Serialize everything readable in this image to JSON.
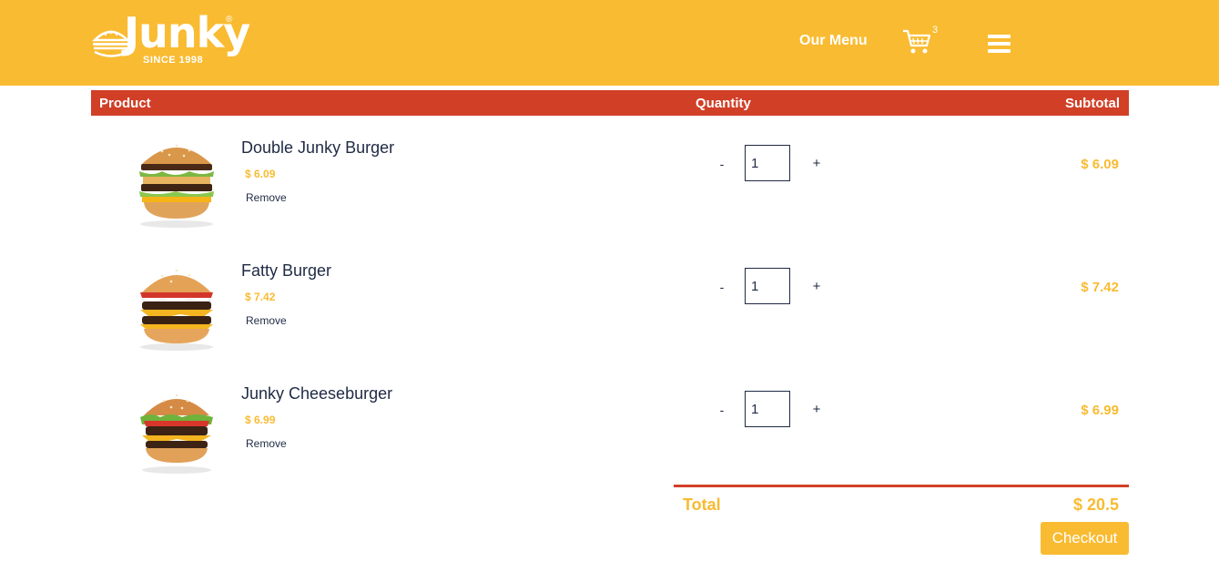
{
  "brand": {
    "name": "Junky",
    "registered": "®",
    "tagline": "SINCE 1998"
  },
  "nav": {
    "menu_label": "Our Menu",
    "cart_count": "3",
    "cart_icon": "shopping-cart-icon",
    "menu_icon": "hamburger-menu-icon"
  },
  "table": {
    "headers": {
      "product": "Product",
      "quantity": "Quantity",
      "subtotal": "Subtotal"
    },
    "items": [
      {
        "name": "Double Junky Burger",
        "price": "$ 6.09",
        "remove": "Remove",
        "minus": "-",
        "quantity": "1",
        "plus": "+",
        "subtotal": "$ 6.09"
      },
      {
        "name": "Fatty Burger",
        "price": "$ 7.42",
        "remove": "Remove",
        "minus": "-",
        "quantity": "1",
        "plus": "+",
        "subtotal": "$ 7.42"
      },
      {
        "name": "Junky Cheeseburger",
        "price": "$ 6.99",
        "remove": "Remove",
        "minus": "-",
        "quantity": "1",
        "plus": "+",
        "subtotal": "$ 6.99"
      }
    ]
  },
  "summary": {
    "total_label": "Total",
    "total_value": "$ 20.5",
    "checkout_label": "Checkout"
  },
  "colors": {
    "brand_yellow": "#f9bb31",
    "header_red": "#d13f27",
    "text_navy": "#1f2a44"
  }
}
